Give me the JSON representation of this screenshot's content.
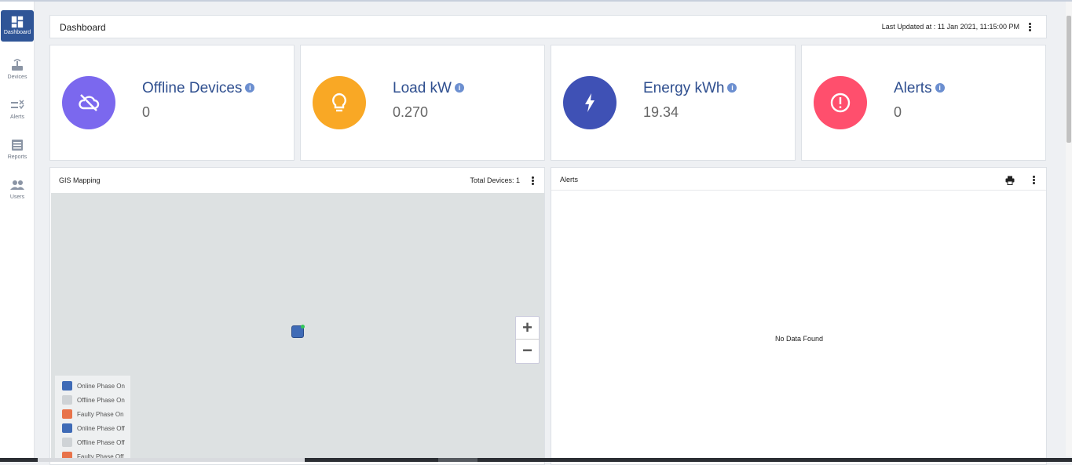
{
  "sidebar": {
    "items": [
      {
        "label": "Dashboard",
        "icon": "dashboard-icon",
        "active": true
      },
      {
        "label": "Devices",
        "icon": "router-icon",
        "active": false
      },
      {
        "label": "Alerts",
        "icon": "alerts-icon",
        "active": false
      },
      {
        "label": "Reports",
        "icon": "reports-icon",
        "active": false
      },
      {
        "label": "Users",
        "icon": "users-icon",
        "active": false
      }
    ]
  },
  "header": {
    "title": "Dashboard",
    "last_updated": "Last Updated at : 11 Jan 2021, 11:15:00 PM"
  },
  "cards": [
    {
      "title": "Offline Devices",
      "value": "0",
      "icon": "cloud-off-icon",
      "color": "#7b68ee"
    },
    {
      "title": "Load kW",
      "value": "0.270",
      "icon": "lightbulb-icon",
      "color": "#f9a825"
    },
    {
      "title": "Energy kWh",
      "value": "19.34",
      "icon": "lightning-bolt-icon",
      "color": "#3f51b5"
    },
    {
      "title": "Alerts",
      "value": "0",
      "icon": "alert-circle-icon",
      "color": "#ff4f6d"
    }
  ],
  "gis": {
    "title": "GIS Mapping",
    "total_devices": "Total Devices: 1",
    "zoom_in": "+",
    "zoom_out": "−",
    "legend": [
      {
        "label": "Online Phase On",
        "color": "#3f6bb6"
      },
      {
        "label": "Offline Phase On",
        "color": "#cfd3d6"
      },
      {
        "label": "Faulty Phase On",
        "color": "#e8734a"
      },
      {
        "label": "Online Phase Off",
        "color": "#3f6bb6"
      },
      {
        "label": "Offline Phase Off",
        "color": "#cfd3d6"
      },
      {
        "label": "Faulty Phase Off",
        "color": "#e8734a"
      }
    ]
  },
  "alerts_panel": {
    "title": "Alerts",
    "empty_text": "No Data Found"
  }
}
